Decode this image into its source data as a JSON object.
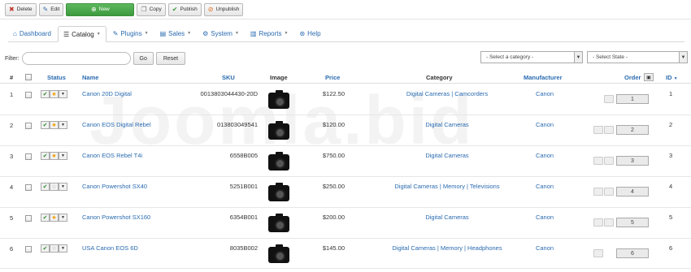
{
  "toolbar": {
    "delete": "Delete",
    "edit": "Edit",
    "new": "New",
    "copy": "Copy",
    "publish": "Publish",
    "unpublish": "Unpublish"
  },
  "menu": {
    "items": [
      {
        "label": "Dashboard",
        "icon": "home-icon"
      },
      {
        "label": "Catalog",
        "icon": "list-icon",
        "active": true
      },
      {
        "label": "Plugins",
        "icon": "wrench-icon"
      },
      {
        "label": "Sales",
        "icon": "cart-icon"
      },
      {
        "label": "System",
        "icon": "gear-icon"
      },
      {
        "label": "Reports",
        "icon": "chart-icon"
      },
      {
        "label": "Help",
        "icon": "lifebuoy-icon"
      }
    ]
  },
  "filter": {
    "label": "Filter:",
    "go": "Go",
    "reset": "Reset",
    "category_placeholder": "- Select a category -",
    "state_placeholder": "- Select State -"
  },
  "table": {
    "headers": {
      "num": "#",
      "status": "Status",
      "name": "Name",
      "sku": "SKU",
      "image": "Image",
      "price": "Price",
      "category": "Category",
      "manufacturer": "Manufacturer",
      "order": "Order",
      "id": "ID"
    },
    "rows": [
      {
        "num": "1",
        "name": "Canon 20D Digital",
        "sku": "0013803044430-20D",
        "price": "$122.50",
        "category": "Digital Cameras | Camcorders",
        "manufacturer": "Canon",
        "order": "1",
        "id": "1",
        "featured": true
      },
      {
        "num": "2",
        "name": "Canon EOS Digital Rebel",
        "sku": "013803049541",
        "price": "$120.00",
        "category": "Digital Cameras",
        "manufacturer": "Canon",
        "order": "2",
        "id": "2",
        "featured": true
      },
      {
        "num": "3",
        "name": "Canon EOS Rebel T4i",
        "sku": "6558B005",
        "price": "$750.00",
        "category": "Digital Cameras",
        "manufacturer": "Canon",
        "order": "3",
        "id": "3",
        "featured": true
      },
      {
        "num": "4",
        "name": "Canon Powershot SX40",
        "sku": "5251B001",
        "price": "$250.00",
        "category": "Digital Cameras | Memory | Televisions",
        "manufacturer": "Canon",
        "order": "4",
        "id": "4",
        "featured": false
      },
      {
        "num": "5",
        "name": "Canon Powershot SX160",
        "sku": "6354B001",
        "price": "$200.00",
        "category": "Digital Cameras",
        "manufacturer": "Canon",
        "order": "5",
        "id": "5",
        "featured": true
      },
      {
        "num": "6",
        "name": "USA Canon EOS 6D",
        "sku": "8035B002",
        "price": "$145.00",
        "category": "Digital Cameras | Memory | Headphones",
        "manufacturer": "Canon",
        "order": "6",
        "id": "6",
        "featured": false
      }
    ]
  },
  "watermark": "Joomla.bid",
  "colors": {
    "link": "#2a6bb0",
    "new_button": "#4cae4c"
  }
}
